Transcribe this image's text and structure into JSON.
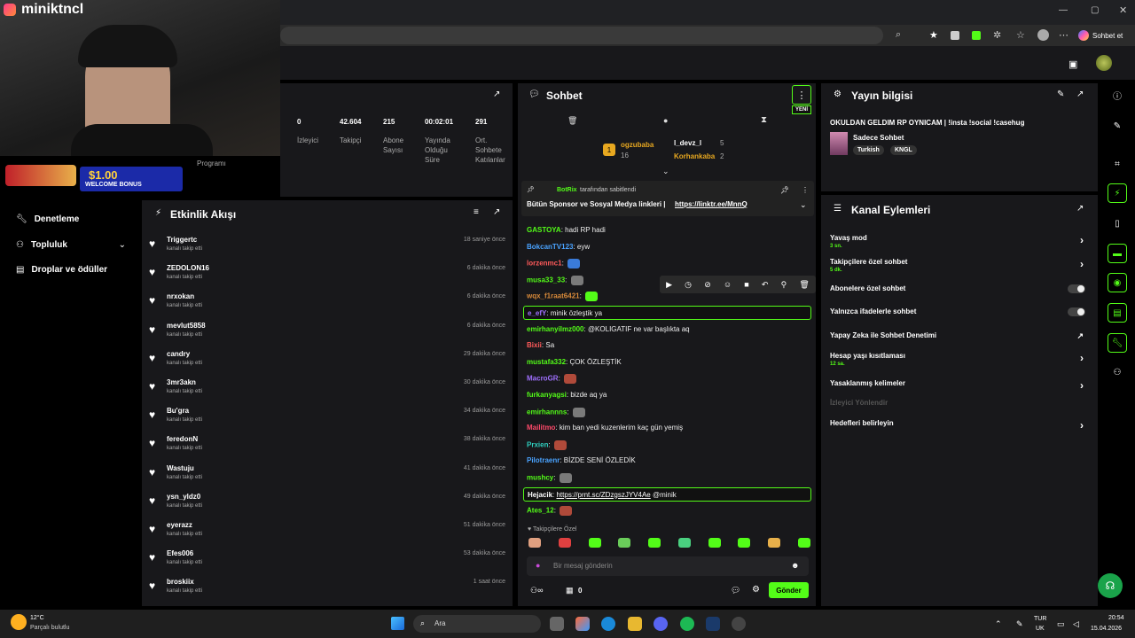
{
  "overlay": {
    "streamer_name": "miniktncl",
    "promo_amount": "$1.00",
    "promo_text": "WELCOME BONUS"
  },
  "browser": {
    "profile_label": "Sohbet et"
  },
  "sidebar": {
    "items": [
      {
        "label": "Denetleme"
      },
      {
        "label": "Topluluk"
      },
      {
        "label": "Droplar ve ödüller"
      }
    ],
    "partial_label": "Programı"
  },
  "stats": [
    {
      "value": "0",
      "label": "İzleyici"
    },
    {
      "value": "42.604",
      "label": "Takipçi"
    },
    {
      "value": "215",
      "label": "Abone Sayısı"
    },
    {
      "value": "00:02:01",
      "label": "Yayında Olduğu Süre"
    },
    {
      "value": "291",
      "label": "Ort. Sohbete Katılanlar"
    }
  ],
  "activity": {
    "title": "Etkinlik Akışı",
    "event_text": "kanalı takip etti",
    "items": [
      {
        "name": "Triggertc",
        "time": "18 saniye önce"
      },
      {
        "name": "ZEDOLON16",
        "time": "6 dakika önce"
      },
      {
        "name": "nrxokan",
        "time": "6 dakika önce"
      },
      {
        "name": "mevlut5858",
        "time": "6 dakika önce"
      },
      {
        "name": "candry",
        "time": "29 dakika önce"
      },
      {
        "name": "3mr3akn",
        "time": "30 dakika önce"
      },
      {
        "name": "Bu'gra",
        "time": "34 dakika önce"
      },
      {
        "name": "feredonN",
        "time": "38 dakika önce"
      },
      {
        "name": "Wastuju",
        "time": "41 dakika önce"
      },
      {
        "name": "ysn_yldz0",
        "time": "49 dakika önce"
      },
      {
        "name": "eyerazz",
        "time": "51 dakika önce"
      },
      {
        "name": "Efes006",
        "time": "53 dakika önce"
      },
      {
        "name": "broskiix",
        "time": "1 saat önce"
      }
    ]
  },
  "chat": {
    "title": "Sohbet",
    "new_badge": "YENİ",
    "leaders": [
      {
        "name": "ogzubaba",
        "count": "16"
      },
      {
        "name": "l_devz_l",
        "count": "5"
      },
      {
        "name": "Korhankaba",
        "count": "2"
      }
    ],
    "leader_rank": "1",
    "pinned": {
      "by": "BotRix",
      "by_suffix": "tarafından sabitlendi",
      "text": "Bütün Sponsor ve Sosyal Medya linkleri |",
      "link": "https://linktr.ee/MnnQ"
    },
    "messages": [
      {
        "user": "GASTOYA",
        "color": "#53fc18",
        "text": "hadi RP hadi"
      },
      {
        "user": "BokcanTV123",
        "color": "#4aa3ff",
        "text": "eyw"
      },
      {
        "user": "lorzenmc1",
        "color": "#ff5a5a",
        "text": ""
      },
      {
        "user": "musa33_33",
        "color": "#53fc18",
        "text": ""
      },
      {
        "user": "wqx_f1raat6421",
        "color": "#d98a3a",
        "text": ""
      },
      {
        "user": "e_efY",
        "color": "#a070ff",
        "text": "minik özleştik ya"
      },
      {
        "user": "emirhanyilmz000",
        "color": "#53fc18",
        "text": "@KOLIGATIF ne var başlıkta aq"
      },
      {
        "user": "Bixii",
        "color": "#ff5a5a",
        "text": "Sa"
      },
      {
        "user": "mustafa332",
        "color": "#53fc18",
        "text": "ÇOK ÖZLEŞTİK"
      },
      {
        "user": "MacroGR",
        "color": "#a070ff",
        "text": ""
      },
      {
        "user": "furkanyagsi",
        "color": "#53fc18",
        "text": "bizde aq ya"
      },
      {
        "user": "emirhannns",
        "color": "#53fc18",
        "text": ""
      },
      {
        "user": "Mailitmo",
        "color": "#ff4a6a",
        "text": "kim ban yedi kuzenlerim kaç gün yemiş"
      },
      {
        "user": "Prxien",
        "color": "#2fd0c0",
        "text": ""
      },
      {
        "user": "Pilotraenr",
        "color": "#4aa3ff",
        "text": "BİZDE SENİ ÖZLEDİK"
      },
      {
        "user": "mushcy",
        "color": "#53fc18",
        "text": ""
      },
      {
        "user": "Hejacik",
        "color": "#fff",
        "text": "@minik",
        "link": "https://prnt.sc/ZDzgszJYV4Ae"
      },
      {
        "user": "Ates_12",
        "color": "#53fc18",
        "text": ""
      }
    ],
    "followers_only": "Takipçilere Özel",
    "input_placeholder": "Bir mesaj gönderin",
    "viewers": "0",
    "send_label": "Gönder"
  },
  "stream_info": {
    "title": "Yayın bilgisi",
    "stream_title": "OKULDAN GELDIM RP OYNICAM | !insta !social !casehug",
    "category": "Sadece Sohbet",
    "tags": [
      "Turkish",
      "KNGL"
    ]
  },
  "channel_actions": {
    "title": "Kanal Eylemleri",
    "rows": [
      {
        "label": "Yavaş mod",
        "sub": "3 sn.",
        "type": "chevron"
      },
      {
        "label": "Takipçilere özel sohbet",
        "sub": "5 dk.",
        "type": "chevron"
      },
      {
        "label": "Abonelere özel sohbet",
        "sub": "",
        "type": "toggle"
      },
      {
        "label": "Yalnızca ifadelerle sohbet",
        "sub": "",
        "type": "toggle"
      },
      {
        "label": "Yapay Zeka ile Sohbet Denetimi",
        "sub": "",
        "type": "external"
      },
      {
        "label": "Hesap yaşı kısıtlaması",
        "sub": "12 sa.",
        "type": "chevron"
      },
      {
        "label": "Yasaklanmış kelimeler",
        "sub": "",
        "type": "chevron"
      },
      {
        "label": "İzleyici Yönlendir",
        "sub": "",
        "type": "disabled"
      },
      {
        "label": "Hedefleri belirleyin",
        "sub": "",
        "type": "chevron"
      }
    ]
  },
  "taskbar": {
    "temp": "12°C",
    "weather": "Parçalı bulutlu",
    "search": "Ara",
    "lang1": "TUR",
    "lang2": "UK",
    "time": "20:54",
    "date": "15.04.2026"
  },
  "colors": {
    "accent": "#53fc18",
    "panel": "#18181b",
    "bg": "#000000"
  }
}
